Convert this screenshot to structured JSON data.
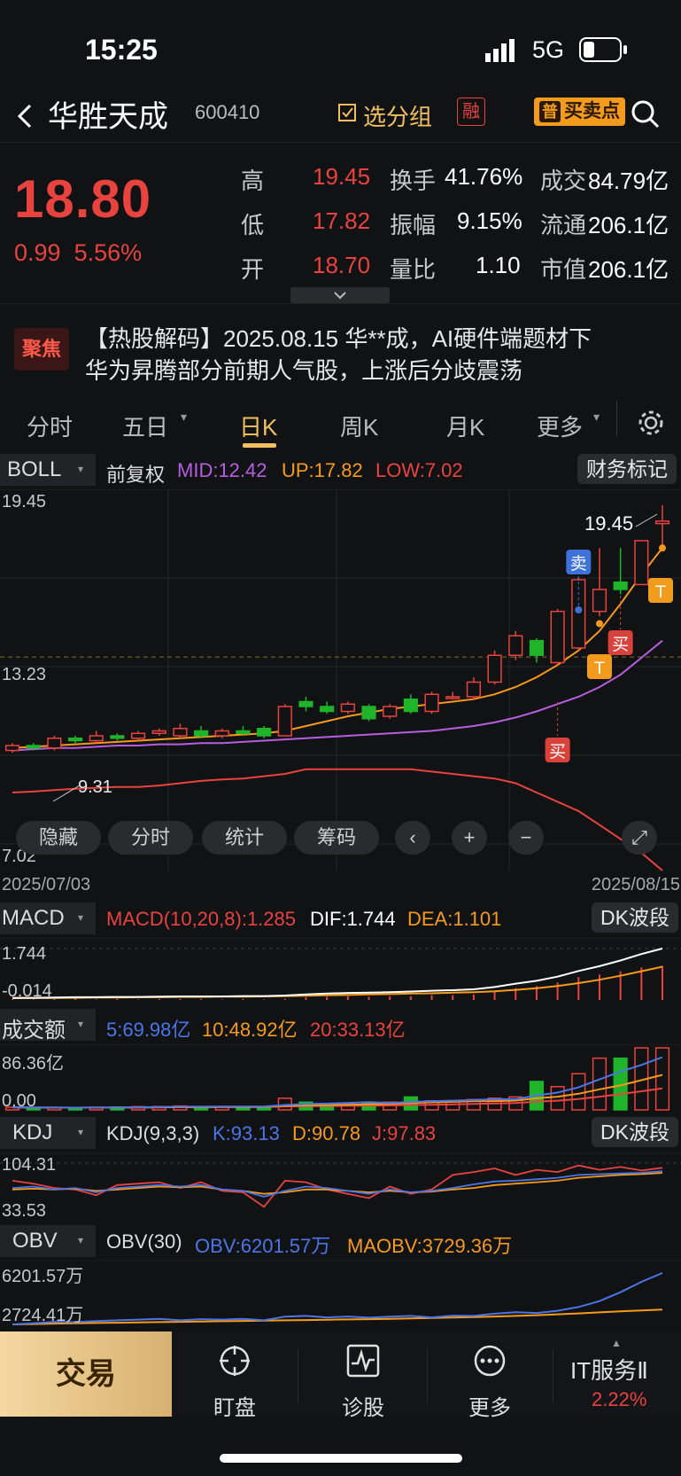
{
  "status": {
    "time": "15:25",
    "network": "5G"
  },
  "header": {
    "back_icon": "chevron-left-icon",
    "stock_name": "华胜天成",
    "stock_code": "600410",
    "group_label": "选分组",
    "margin_badge": "融",
    "bs_icon_label": "普",
    "bs_label": "买卖点",
    "search_icon": "search-icon"
  },
  "quote": {
    "price": "18.80",
    "change": "0.99",
    "change_pct": "5.56%",
    "high_label": "高",
    "high": "19.45",
    "low_label": "低",
    "low": "17.82",
    "open_label": "开",
    "open": "18.70",
    "turnover_label": "换手",
    "turnover": "41.76%",
    "amplitude_label": "振幅",
    "amplitude": "9.15%",
    "volratio_label": "量比",
    "volratio": "1.10",
    "deal_label": "成交",
    "deal": "84.79亿",
    "float_label": "流通",
    "float": "206.1亿",
    "mcap_label": "市值",
    "mcap": "206.1亿"
  },
  "news": {
    "badge": "聚焦",
    "line1": "【热股解码】2025.08.15 华**成，AI硬件端题材下",
    "line2": "华为昇腾部分前期人气股，上涨后分歧震荡"
  },
  "tabs": [
    "分时",
    "五日",
    "日K",
    "周K",
    "月K",
    "更多"
  ],
  "tab_active": "日K",
  "boll": {
    "name": "BOLL",
    "adj": "前复权",
    "mid": "MID:12.42",
    "up": "UP:17.82",
    "low": "LOW:7.02",
    "fin_mark": "财务标记",
    "top": "19.45",
    "mid_tick": "13.23",
    "bottom": "7.02",
    "min_mark": "9.31",
    "max_mark": "19.45",
    "date_start": "2025/07/03",
    "date_end": "2025/08/15",
    "sell": "卖",
    "buy": "买",
    "t": "T"
  },
  "toolbar": [
    "隐藏",
    "分时",
    "统计",
    "筹码"
  ],
  "macd": {
    "name": "MACD",
    "params": "MACD(10,20,8):1.285",
    "dif": "DIF:1.744",
    "dea": "DEA:1.101",
    "band": "DK波段",
    "top": "1.744",
    "bottom": "-0.014"
  },
  "volume": {
    "name": "成交额",
    "ma5": "5:69.98亿",
    "ma10": "10:48.92亿",
    "ma20": "20:33.13亿",
    "top": "86.36亿",
    "bottom": "0.00"
  },
  "kdj": {
    "name": "KDJ",
    "params": "KDJ(9,3,3)",
    "k": "K:93.13",
    "d": "D:90.78",
    "j": "J:97.83",
    "band": "DK波段",
    "top": "104.31",
    "bottom": "33.53"
  },
  "obv": {
    "name": "OBV",
    "params": "OBV(30)",
    "obv": "OBV:6201.57万",
    "maobv": "MAOBV:3729.36万",
    "top": "6201.57万",
    "bottom": "2724.41万"
  },
  "bottom_nav": {
    "trade": "交易",
    "watch": "盯盘",
    "diagnose": "诊股",
    "more": "更多",
    "sector": "IT服务Ⅱ",
    "sector_pct": "2.22%"
  },
  "colors": {
    "up": "#e8433f",
    "down": "#1fb42a",
    "accent": "#f59a1b",
    "mid": "#f59a1b",
    "upper": "#b65ee0",
    "lower": "#e8433f"
  },
  "chart_data": {
    "type": "candlestick",
    "title": "",
    "ylim": [
      7.02,
      19.45
    ],
    "candles": [
      {
        "o": 9.4,
        "c": 9.6,
        "h": 9.7,
        "l": 9.31
      },
      {
        "o": 9.6,
        "c": 9.5,
        "h": 9.7,
        "l": 9.4
      },
      {
        "o": 9.5,
        "c": 9.9,
        "h": 10.0,
        "l": 9.4
      },
      {
        "o": 9.9,
        "c": 9.8,
        "h": 10.0,
        "l": 9.7
      },
      {
        "o": 9.8,
        "c": 10.0,
        "h": 10.2,
        "l": 9.7
      },
      {
        "o": 10.0,
        "c": 9.9,
        "h": 10.1,
        "l": 9.8
      },
      {
        "o": 9.9,
        "c": 10.1,
        "h": 10.2,
        "l": 9.8
      },
      {
        "o": 10.1,
        "c": 10.2,
        "h": 10.3,
        "l": 10.0
      },
      {
        "o": 10.0,
        "c": 10.3,
        "h": 10.5,
        "l": 9.9
      },
      {
        "o": 10.2,
        "c": 10.0,
        "h": 10.4,
        "l": 9.9
      },
      {
        "o": 10.0,
        "c": 10.2,
        "h": 10.3,
        "l": 9.9
      },
      {
        "o": 10.2,
        "c": 10.1,
        "h": 10.4,
        "l": 10.0
      },
      {
        "o": 10.3,
        "c": 10.0,
        "h": 10.4,
        "l": 9.9
      },
      {
        "o": 10.0,
        "c": 11.2,
        "h": 11.3,
        "l": 10.0
      },
      {
        "o": 11.4,
        "c": 11.2,
        "h": 11.6,
        "l": 11.0
      },
      {
        "o": 11.2,
        "c": 11.0,
        "h": 11.4,
        "l": 10.9
      },
      {
        "o": 11.0,
        "c": 11.3,
        "h": 11.4,
        "l": 10.9
      },
      {
        "o": 11.2,
        "c": 10.7,
        "h": 11.3,
        "l": 10.6
      },
      {
        "o": 10.8,
        "c": 11.2,
        "h": 11.3,
        "l": 10.7
      },
      {
        "o": 11.5,
        "c": 11.0,
        "h": 11.7,
        "l": 10.9
      },
      {
        "o": 11.0,
        "c": 11.7,
        "h": 11.8,
        "l": 10.9
      },
      {
        "o": 11.6,
        "c": 11.6,
        "h": 11.8,
        "l": 11.5
      },
      {
        "o": 11.6,
        "c": 12.2,
        "h": 12.4,
        "l": 11.5
      },
      {
        "o": 12.2,
        "c": 13.3,
        "h": 13.5,
        "l": 12.1
      },
      {
        "o": 13.3,
        "c": 14.1,
        "h": 14.3,
        "l": 13.1
      },
      {
        "o": 13.9,
        "c": 13.3,
        "h": 14.0,
        "l": 13.0
      },
      {
        "o": 13.0,
        "c": 15.1,
        "h": 15.2,
        "l": 12.9
      },
      {
        "o": 13.6,
        "c": 16.4,
        "h": 16.5,
        "l": 13.5
      },
      {
        "o": 15.1,
        "c": 16.0,
        "h": 17.7,
        "l": 14.9
      },
      {
        "o": 16.3,
        "c": 16.0,
        "h": 17.7,
        "l": 15.8
      },
      {
        "o": 16.2,
        "c": 18.0,
        "h": 18.0,
        "l": 16.2
      },
      {
        "o": 18.7,
        "c": 18.8,
        "h": 19.45,
        "l": 17.82
      }
    ],
    "mid": [
      9.5,
      9.55,
      9.6,
      9.65,
      9.7,
      9.75,
      9.8,
      9.85,
      9.9,
      9.95,
      10.0,
      10.05,
      10.1,
      10.2,
      10.4,
      10.6,
      10.8,
      10.95,
      11.1,
      11.2,
      11.3,
      11.4,
      11.5,
      11.7,
      12.0,
      12.4,
      12.9,
      13.5,
      14.3,
      15.4,
      16.6,
      17.7
    ],
    "upper": [
      9.4,
      9.45,
      9.5,
      9.5,
      9.55,
      9.6,
      9.6,
      9.65,
      9.65,
      9.7,
      9.7,
      9.75,
      9.8,
      9.85,
      9.9,
      9.95,
      10.0,
      10.05,
      10.1,
      10.15,
      10.2,
      10.3,
      10.4,
      10.55,
      10.75,
      11.0,
      11.3,
      11.6,
      12.0,
      12.5,
      13.2,
      13.9
    ],
    "lower": [
      8.7,
      8.72,
      8.75,
      8.78,
      8.8,
      8.82,
      8.82,
      8.85,
      8.9,
      8.95,
      8.98,
      9.0,
      9.05,
      9.1,
      9.2,
      9.2,
      9.2,
      9.2,
      9.2,
      9.2,
      9.15,
      9.1,
      9.05,
      9.0,
      8.9,
      8.7,
      8.5,
      8.3,
      8.0,
      7.7,
      7.4,
      7.02
    ],
    "macd_dif": [
      0.0,
      0.0,
      0.01,
      0.02,
      0.02,
      0.03,
      0.03,
      0.04,
      0.05,
      0.05,
      0.05,
      0.06,
      0.06,
      0.08,
      0.12,
      0.15,
      0.17,
      0.18,
      0.2,
      0.22,
      0.25,
      0.27,
      0.3,
      0.38,
      0.5,
      0.6,
      0.75,
      0.95,
      1.12,
      1.32,
      1.55,
      1.744
    ],
    "macd_dea": [
      -0.014,
      -0.01,
      -0.005,
      0.0,
      0.01,
      0.01,
      0.02,
      0.02,
      0.03,
      0.03,
      0.04,
      0.04,
      0.05,
      0.06,
      0.07,
      0.09,
      0.1,
      0.12,
      0.13,
      0.15,
      0.16,
      0.18,
      0.2,
      0.23,
      0.28,
      0.34,
      0.42,
      0.52,
      0.64,
      0.78,
      0.94,
      1.101
    ],
    "volume": [
      2.0,
      1.5,
      1.8,
      1.5,
      2.0,
      2.2,
      2.5,
      2.6,
      3.0,
      2.2,
      2.5,
      2.4,
      2.6,
      9.0,
      6.0,
      4.5,
      5.0,
      5.5,
      6.0,
      10.0,
      7.0,
      7.0,
      8.0,
      9.0,
      10.0,
      22.0,
      18.0,
      28.0,
      40.0,
      40.0,
      48.0,
      48.0
    ],
    "kdj_k": [
      70,
      72,
      68,
      70,
      64,
      70,
      72,
      74,
      72,
      74,
      68,
      66,
      58,
      66,
      72,
      70,
      66,
      62,
      68,
      64,
      66,
      70,
      75,
      79,
      80,
      82,
      84,
      88,
      89,
      90,
      91,
      93.13
    ],
    "kdj_d": [
      68,
      69,
      68,
      69,
      66,
      68,
      70,
      72,
      71,
      72,
      68,
      66,
      62,
      64,
      68,
      68,
      66,
      64,
      66,
      64,
      65,
      68,
      70,
      74,
      76,
      78,
      80,
      84,
      86,
      88,
      89,
      90.78
    ],
    "kdj_j": [
      80,
      76,
      70,
      68,
      60,
      74,
      76,
      78,
      70,
      78,
      66,
      64,
      44,
      80,
      78,
      68,
      62,
      56,
      72,
      62,
      68,
      88,
      92,
      97,
      88,
      95,
      92,
      101,
      95,
      99,
      94,
      97.83
    ],
    "obv": [
      2724.41,
      2800,
      2900,
      2880,
      2950,
      3000,
      3050,
      3100,
      3000,
      3080,
      3050,
      3100,
      3000,
      3250,
      3300,
      3200,
      3260,
      3180,
      3250,
      3300,
      3200,
      3320,
      3300,
      3450,
      3550,
      3500,
      3650,
      3900,
      4300,
      4900,
      5600,
      6201.57
    ],
    "maobv": [
      2724.41,
      2750,
      2780,
      2800,
      2820,
      2840,
      2860,
      2880,
      2900,
      2920,
      2940,
      2960,
      2980,
      3000,
      3020,
      3040,
      3060,
      3080,
      3100,
      3130,
      3160,
      3190,
      3220,
      3260,
      3300,
      3350,
      3410,
      3470,
      3540,
      3610,
      3670,
      3729.36
    ]
  }
}
